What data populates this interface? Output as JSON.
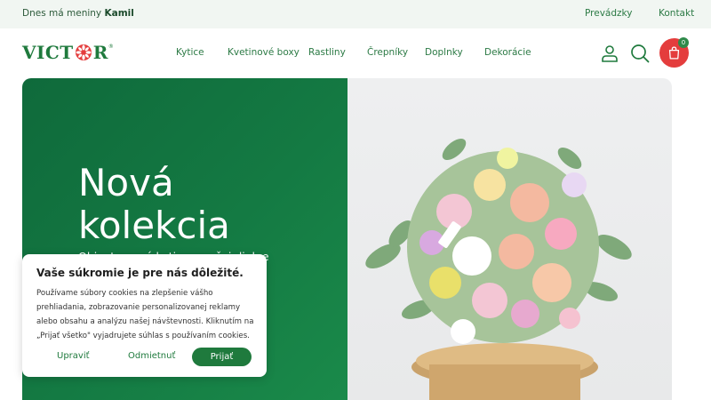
{
  "topbar": {
    "nameday_prefix": "Dnes má meniny",
    "nameday_name": "Kamil",
    "links": [
      "Prevádzky",
      "Kontakt"
    ]
  },
  "header": {
    "logo_text_left": "VICT",
    "logo_text_right": "R",
    "logo_reg": "®",
    "nav": [
      "Kytice",
      "Kvetinové boxy",
      "Rastliny",
      "Črepníky",
      "Doplnky",
      "Dekorácie"
    ],
    "cart_count": "0",
    "icons": [
      "user-icon",
      "search-icon",
      "cart-icon"
    ]
  },
  "hero": {
    "title_line1": "Nová",
    "title_line2": "kolekcia",
    "subtitle": "Objavte nové kytice z našej dielne",
    "image": "flower-bouquet-on-wooden-stand",
    "colors": {
      "green": "#147a43",
      "accent_red": "#e43d3d"
    }
  },
  "cookie": {
    "title": "Vaše súkromie je pre nás dôležité.",
    "text": "Používame súbory cookies na zlepšenie vášho prehliadania, zobrazovanie personalizovanej reklamy alebo obsahu a analýzu našej návštevnosti. Kliknutím na „Prijať všetko\" vyjadrujete súhlas s používaním cookies.",
    "customize": "Upraviť",
    "reject": "Odmietnuť",
    "accept": "Prijať"
  }
}
